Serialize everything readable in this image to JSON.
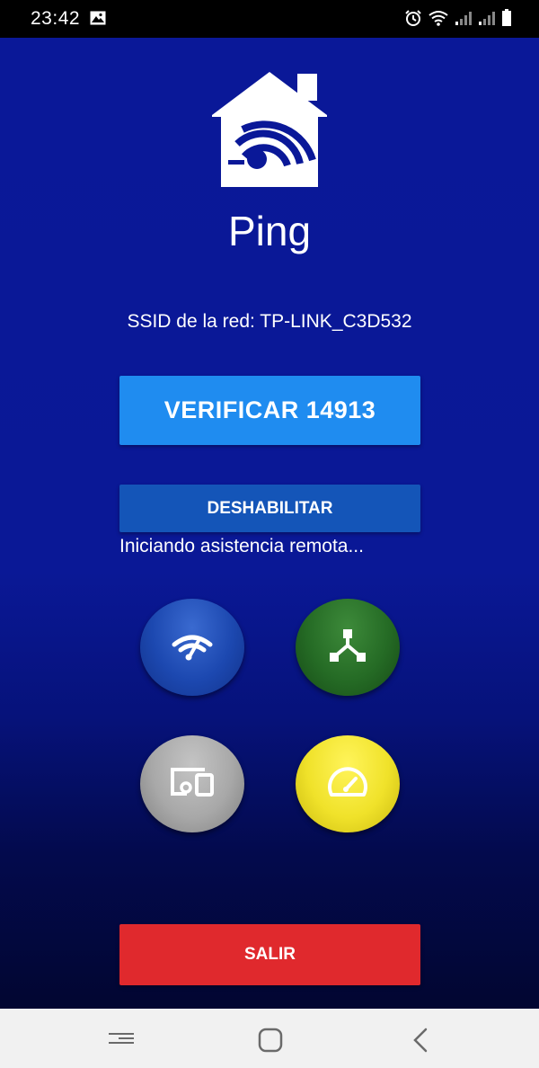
{
  "status_bar": {
    "time": "23:42",
    "icons": [
      "image-icon",
      "alarm-icon",
      "wifi-icon",
      "signal-icon",
      "signal-icon",
      "battery-icon"
    ]
  },
  "app": {
    "title": "Ping",
    "logo_icon": "house-wifi-logo",
    "ssid_text": "SSID de la red: TP-LINK_C3D532",
    "verify_button": "VERIFICAR 14913",
    "disable_button": "DESHABILITAR",
    "remote_status": "Iniciando asistencia remota...",
    "feature_buttons": [
      {
        "icon": "wifi-icon",
        "color": "#1c48b0"
      },
      {
        "icon": "network-icon",
        "color": "#256b25"
      },
      {
        "icon": "devices-icon",
        "color": "#a8a8a8"
      },
      {
        "icon": "speedometer-icon",
        "color": "#f0e22a"
      }
    ],
    "exit_button": "SALIR",
    "colors": {
      "background": "#0a1898",
      "verify": "#1f8cf0",
      "disable": "#1455b8",
      "exit": "#e0292d"
    }
  },
  "nav_bar": {
    "buttons": [
      "recent-apps-icon",
      "home-icon",
      "back-icon"
    ]
  }
}
